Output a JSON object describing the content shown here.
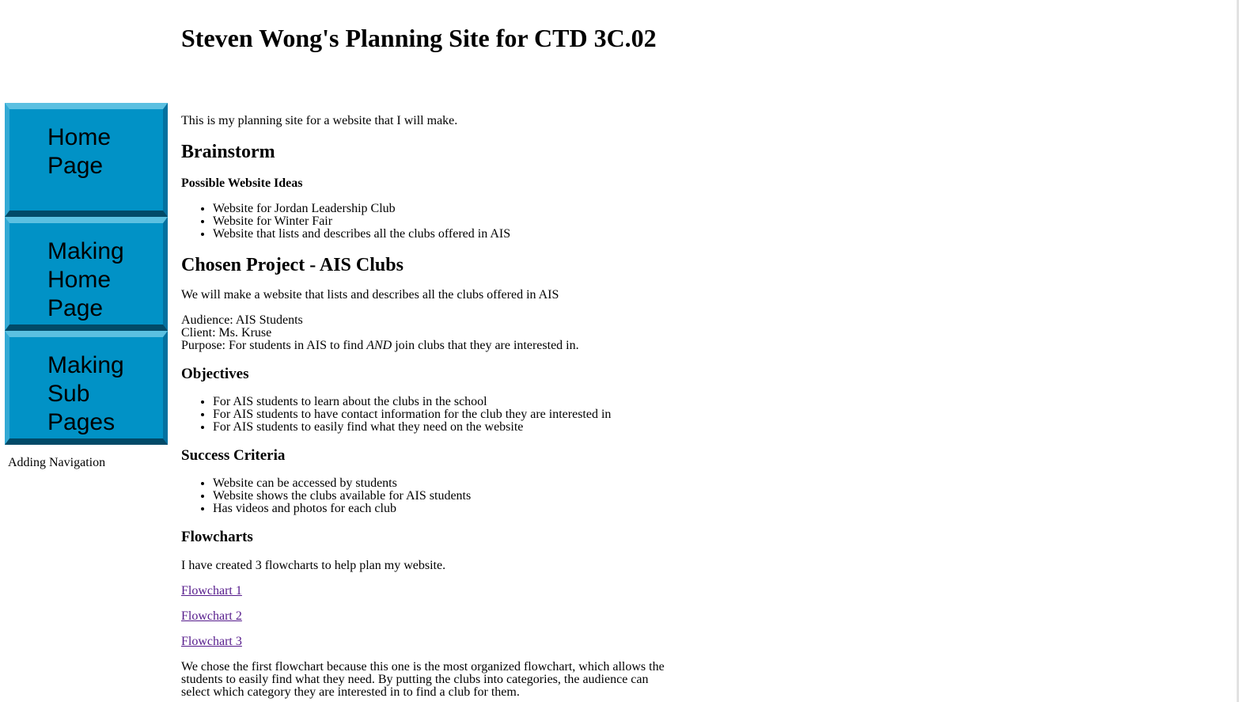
{
  "header": {
    "title": "Steven Wong's Planning Site for CTD 3C.02"
  },
  "nav": {
    "buttons": [
      {
        "label": "Home Page"
      },
      {
        "label": "Making Home Page"
      },
      {
        "label": "Making Sub Pages"
      }
    ],
    "extra_link": "Adding Navigation"
  },
  "content": {
    "intro": "This is my planning site for a website that I will make.",
    "brainstorm": {
      "heading": "Brainstorm",
      "subheading": "Possible Website Ideas",
      "ideas": [
        "Website for Jordan Leadership Club",
        "Website for Winter Fair",
        "Website that lists and describes all the clubs offered in AIS"
      ]
    },
    "chosen": {
      "heading": "Chosen Project - AIS Clubs",
      "description": "We will make a website that lists and describes all the clubs offered in AIS",
      "audience": "Audience: AIS Students",
      "client": "Client: Ms. Kruse",
      "purpose_before": "Purpose: For students in AIS to find ",
      "purpose_emphasis": "AND",
      "purpose_after": " join clubs that they are interested in."
    },
    "objectives": {
      "heading": "Objectives",
      "items": [
        "For AIS students to learn about the clubs in the school",
        "For AIS students to have contact information for the club they are interested in",
        "For AIS students to easily find what they need on the website"
      ]
    },
    "success": {
      "heading": "Success Criteria",
      "items": [
        "Website can be accessed by students",
        "Website shows the clubs available for AIS students",
        "Has videos and photos for each club"
      ]
    },
    "flowcharts": {
      "heading": "Flowcharts",
      "intro": "I have created 3 flowcharts to help plan my website.",
      "links": [
        "Flowchart 1",
        "Flowchart 2",
        "Flowchart 3"
      ],
      "conclusion": "We chose the first flowchart because this one is the most organized flowchart, which allows the students to easily find what they need. By putting the clubs into categories, the audience can select which category they are interested in to find a club for them."
    }
  },
  "colors": {
    "button_face": "#0192c6",
    "button_highlight": "#5bc0e1",
    "button_shadow": "#014a68",
    "visited_link": "#551a8b"
  }
}
